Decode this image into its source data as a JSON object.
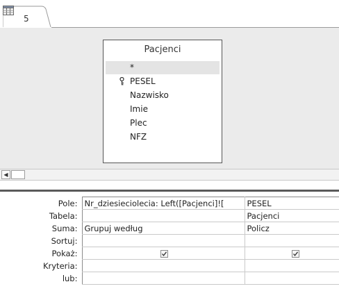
{
  "tabs": [
    {
      "label": "5",
      "icon": "query-design-icon"
    }
  ],
  "table_box": {
    "title": "Pacjenci",
    "fields": [
      {
        "label": "*",
        "key": false,
        "selected": true
      },
      {
        "label": "PESEL",
        "key": true,
        "selected": false
      },
      {
        "label": "Nazwisko",
        "key": false,
        "selected": false
      },
      {
        "label": "Imie",
        "key": false,
        "selected": false
      },
      {
        "label": "Plec",
        "key": false,
        "selected": false
      },
      {
        "label": "NFZ",
        "key": false,
        "selected": false
      }
    ]
  },
  "scrollbar": {
    "left_arrow": "◀"
  },
  "grid": {
    "row_labels": {
      "field": "Pole:",
      "table": "Tabela:",
      "total": "Suma:",
      "sort": "Sortuj:",
      "show": "Pokaż:",
      "criteria": "Kryteria:",
      "or": "lub:"
    },
    "columns": [
      {
        "field": "Nr_dziesieciolecia: Left([Pacjenci]![",
        "table": "",
        "total": "Grupuj według",
        "sort": "",
        "show": true,
        "criteria": "",
        "or": ""
      },
      {
        "field": "PESEL",
        "table": "Pacjenci",
        "total": "Policz",
        "sort": "",
        "show": true,
        "criteria": "",
        "or": ""
      }
    ]
  }
}
